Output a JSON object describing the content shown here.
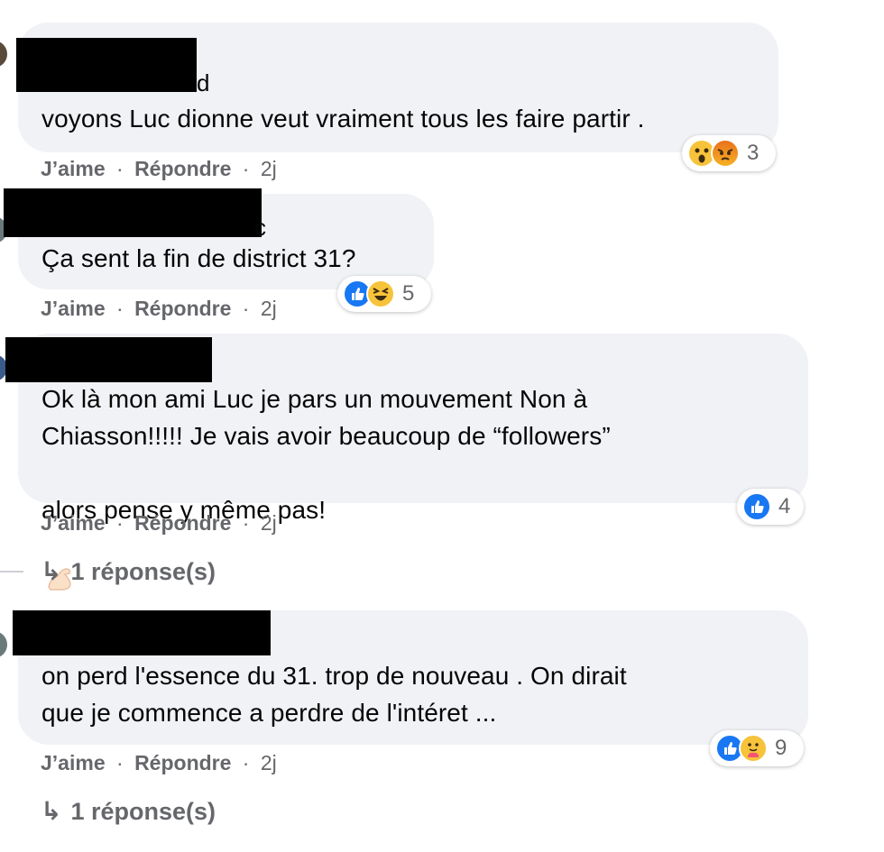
{
  "comments": [
    {
      "name_fragment": "d",
      "text": "voyons Luc dionne veut vraiment tous les faire partir .",
      "like_label": "J’aime",
      "reply_label": "Répondre",
      "time": "2j",
      "reactions": [
        "wow-reaction-icon",
        "angry-reaction-icon"
      ],
      "reaction_count": "3"
    },
    {
      "name_fragment": "c",
      "text": "Ça sent la fin de district 31?",
      "like_label": "J’aime",
      "reply_label": "Répondre",
      "time": "2j",
      "reactions": [
        "like-reaction-icon",
        "haha-reaction-icon"
      ],
      "reaction_count": "5"
    },
    {
      "text_line1": "Ok là mon ami Luc je pars un mouvement Non à",
      "text_line2": "Chiasson!!!!! Je vais avoir beaucoup de “followers”",
      "text_line3": "alors pense y même pas!",
      "like_label": "J’aime",
      "reply_label": "Répondre",
      "time": "2j",
      "reactions": [
        "like-reaction-icon"
      ],
      "reaction_count": "4",
      "replies_label": "1 réponse(s)"
    },
    {
      "text_line1": "on perd l'essence du 31. trop de nouveau . On dirait",
      "text_line2": "que je commence a perdre de l'intéret ...",
      "like_label": "J’aime",
      "reply_label": "Répondre",
      "time": "2j",
      "reactions": [
        "like-reaction-icon",
        "care-reaction-icon"
      ],
      "reaction_count": "9",
      "replies_label": "1 réponse(s)"
    }
  ],
  "separator": "·",
  "colors": {
    "bubble": "#f0f2f5",
    "meta_text": "#65676b",
    "like_blue": "#1877f2",
    "reaction_yellow": "#f7c33b"
  }
}
